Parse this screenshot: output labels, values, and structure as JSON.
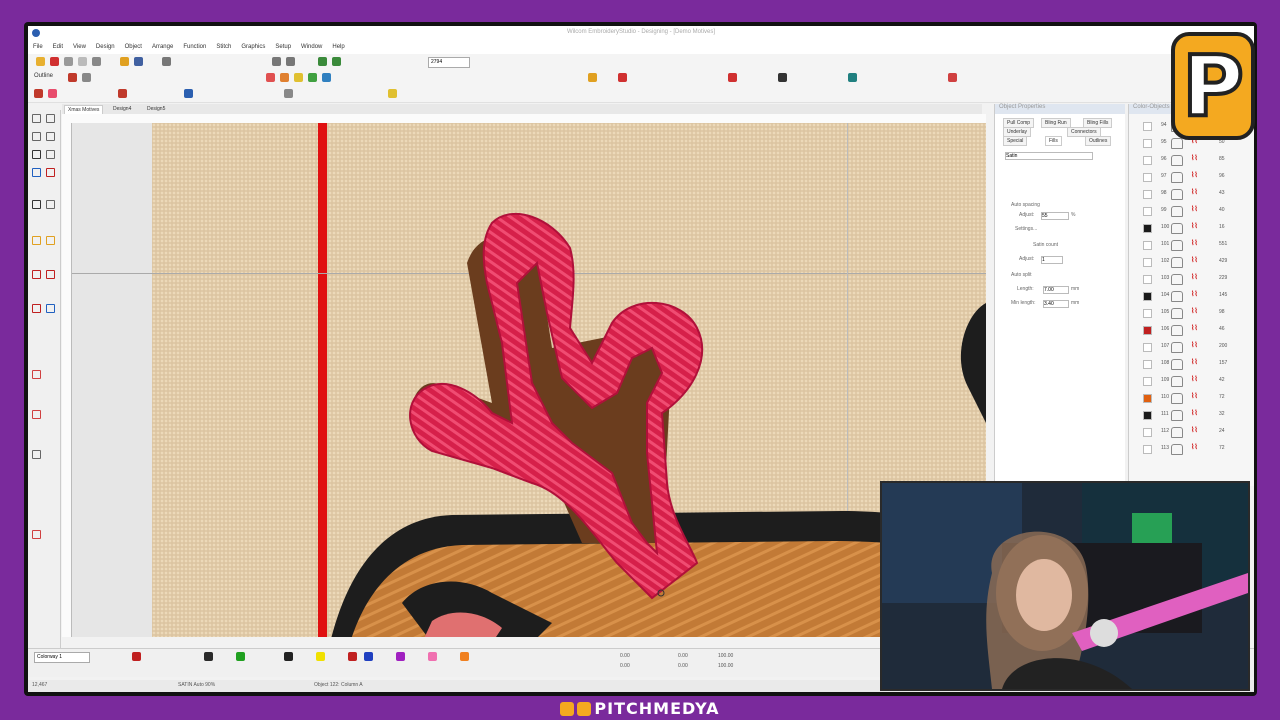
{
  "window": {
    "title": "Wilcom EmbroideryStudio - Designing - [Demo Motives]"
  },
  "menu": [
    "File",
    "Edit",
    "View",
    "Design",
    "Object",
    "Arrange",
    "Function",
    "Stitch",
    "Graphics",
    "Setup",
    "Window",
    "Help"
  ],
  "toolbar": {
    "outline_label": "Outline",
    "zoom_value": "2794"
  },
  "doc_tabs": [
    "Xmas Motives",
    "Design4",
    "Design5"
  ],
  "object_properties": {
    "title": "Object Properties",
    "tabs": [
      "Pull Comp",
      "Bling Run",
      "Bling Fills",
      "Underlay",
      "Connectors",
      "Special",
      "Fills",
      "Outlines"
    ],
    "stitch_type": "Satin",
    "auto_spacing_label": "Auto spacing",
    "adjust_label": "Adjust:",
    "adjust_value": "55",
    "adjust_unit": "%",
    "settings_label": "Settings...",
    "satin_count_label": "Satin count",
    "adjust2_value": "1",
    "auto_split_label": "Auto split",
    "length_label": "Length:",
    "length_value": "7.00",
    "min_length_label": "Min length:",
    "min_length_value": "3.40",
    "unit_mm": "mm"
  },
  "color_objects": {
    "title": "Color-Objects",
    "rows": [
      {
        "n": "94",
        "count": "61",
        "color": "#ffffff"
      },
      {
        "n": "95",
        "count": "50",
        "color": "#ffffff"
      },
      {
        "n": "96",
        "count": "85",
        "color": "#ffffff"
      },
      {
        "n": "97",
        "count": "96",
        "color": "#ffffff"
      },
      {
        "n": "98",
        "count": "43",
        "color": "#ffffff"
      },
      {
        "n": "99",
        "count": "40",
        "color": "#ffffff"
      },
      {
        "n": "100",
        "count": "16",
        "color": "#1a1a1a"
      },
      {
        "n": "101",
        "count": "551",
        "color": "#ffffff"
      },
      {
        "n": "102",
        "count": "429",
        "color": "#ffffff"
      },
      {
        "n": "103",
        "count": "229",
        "color": "#ffffff"
      },
      {
        "n": "104",
        "count": "145",
        "color": "#1a1a1a"
      },
      {
        "n": "105",
        "count": "98",
        "color": "#ffffff"
      },
      {
        "n": "106",
        "count": "46",
        "color": "#c02020"
      },
      {
        "n": "107",
        "count": "200",
        "color": "#ffffff"
      },
      {
        "n": "108",
        "count": "157",
        "color": "#ffffff"
      },
      {
        "n": "109",
        "count": "42",
        "color": "#ffffff"
      },
      {
        "n": "110",
        "count": "72",
        "color": "#e06010"
      },
      {
        "n": "111",
        "count": "32",
        "color": "#1a1a1a"
      },
      {
        "n": "112",
        "count": "24",
        "color": "#ffffff"
      },
      {
        "n": "113",
        "count": "72",
        "color": "#ffffff"
      }
    ]
  },
  "bottom": {
    "colorway": "Colorway 1",
    "position_x": "0.00",
    "position_y": "0.00",
    "width": "0.00",
    "height": "0.00",
    "w_pct": "100.00",
    "h_pct": "100.00"
  },
  "status": {
    "left": "12,467",
    "mid": "SATIN Auto 90%",
    "object": "Object 122: Column A"
  },
  "watermark": {
    "logo_letter": "P",
    "brand": "PITCHMEDYA"
  },
  "colors": {
    "frame": "#7a2a9c",
    "fabric": "#dcc5a2",
    "satin": "#d6204a",
    "needle": "#e01010",
    "outline": "#1d1d1d",
    "brown": "#6b3d1e"
  }
}
